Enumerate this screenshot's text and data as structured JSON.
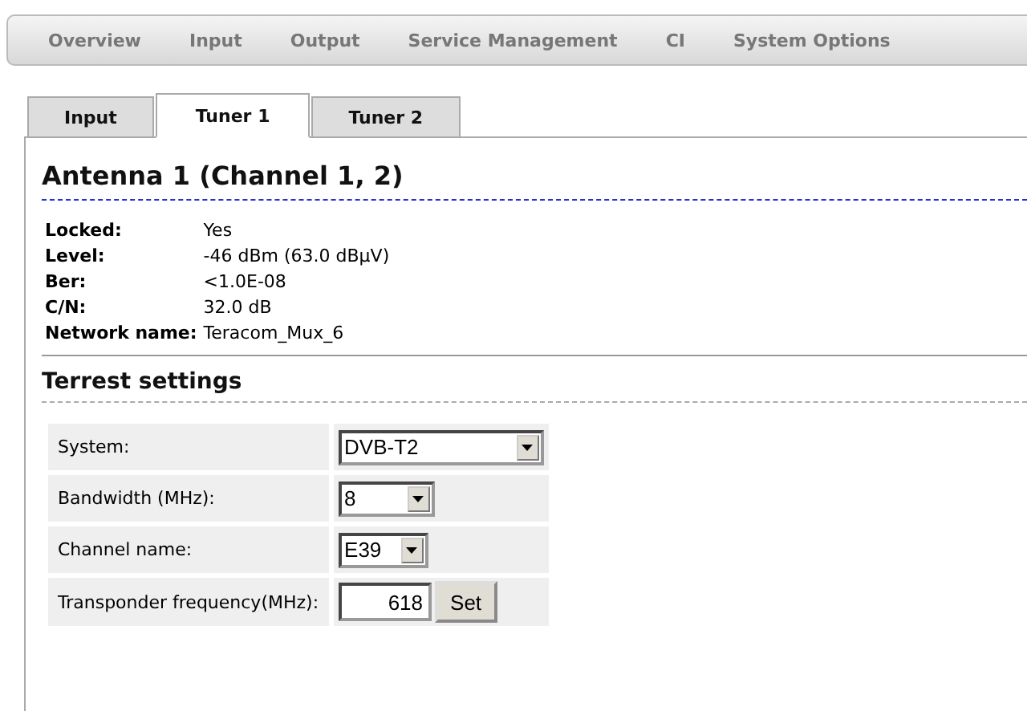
{
  "nav": {
    "items": [
      {
        "label": "Overview"
      },
      {
        "label": "Input"
      },
      {
        "label": "Output"
      },
      {
        "label": "Service Management"
      },
      {
        "label": "CI"
      },
      {
        "label": "System Options"
      }
    ]
  },
  "tabs": [
    {
      "label": "Input",
      "selected": false
    },
    {
      "label": "Tuner 1",
      "selected": true
    },
    {
      "label": "Tuner 2",
      "selected": false
    }
  ],
  "heading": "Antenna 1 (Channel 1, 2)",
  "status": [
    {
      "label": "Locked:",
      "value": "Yes"
    },
    {
      "label": "Level:",
      "value": "-46 dBm (63.0 dBµV)"
    },
    {
      "label": "Ber:",
      "value": "<1.0E-08"
    },
    {
      "label": "C/N:",
      "value": "32.0 dB"
    },
    {
      "label": "Network name:",
      "value": "Teracom_Mux_6"
    }
  ],
  "settings": {
    "title": "Terrest settings",
    "rows": [
      {
        "kind": "select",
        "label": "System:",
        "value": "DVB-T2"
      },
      {
        "kind": "select",
        "label": "Bandwidth (MHz):",
        "value": "8"
      },
      {
        "kind": "select",
        "label": "Channel name:",
        "value": "E39"
      },
      {
        "kind": "input",
        "label": "Transponder frequency(MHz):",
        "value": "618",
        "button": "Set"
      }
    ]
  }
}
